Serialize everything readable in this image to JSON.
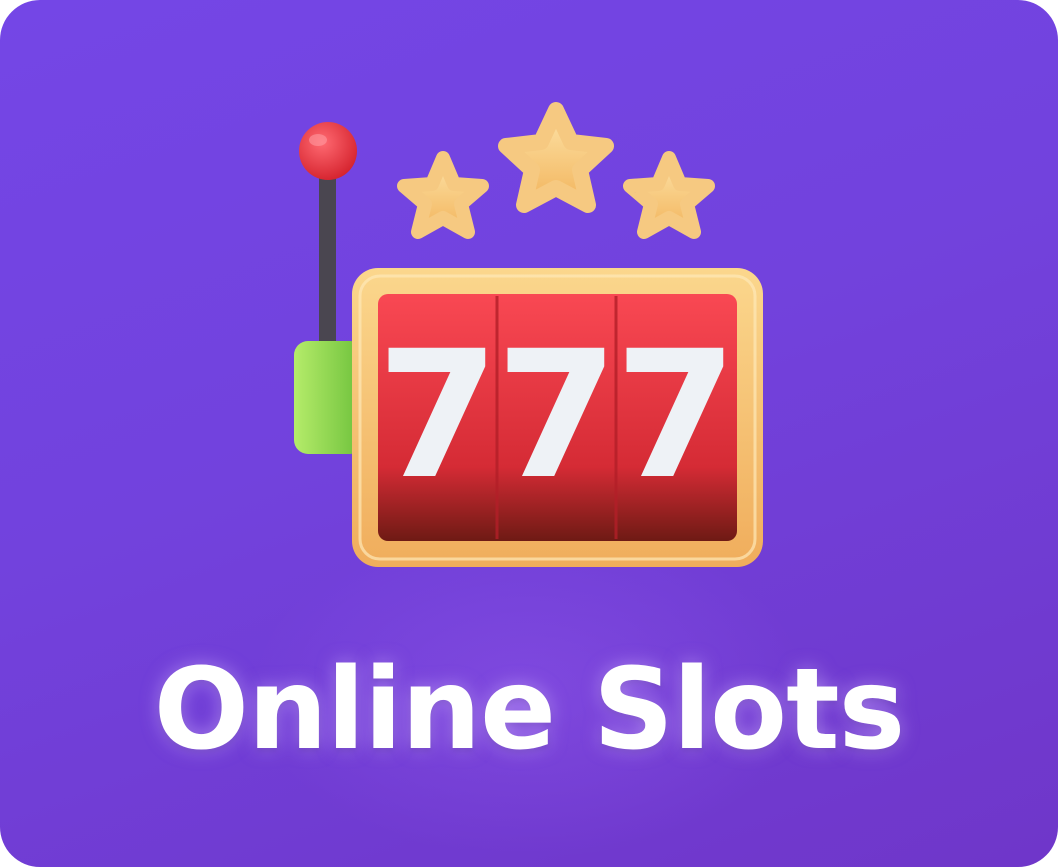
{
  "card": {
    "title": "Online Slots",
    "icon": "slot-machine-icon",
    "background_color": "#7446e6"
  },
  "machine": {
    "reel_symbols": [
      "7",
      "7",
      "7"
    ],
    "stars": 3,
    "reel_color": "#e0323c",
    "frame_color": "#f5c571",
    "lever_knob_color": "#e8323c",
    "side_panel_color": "#8fd84a"
  }
}
